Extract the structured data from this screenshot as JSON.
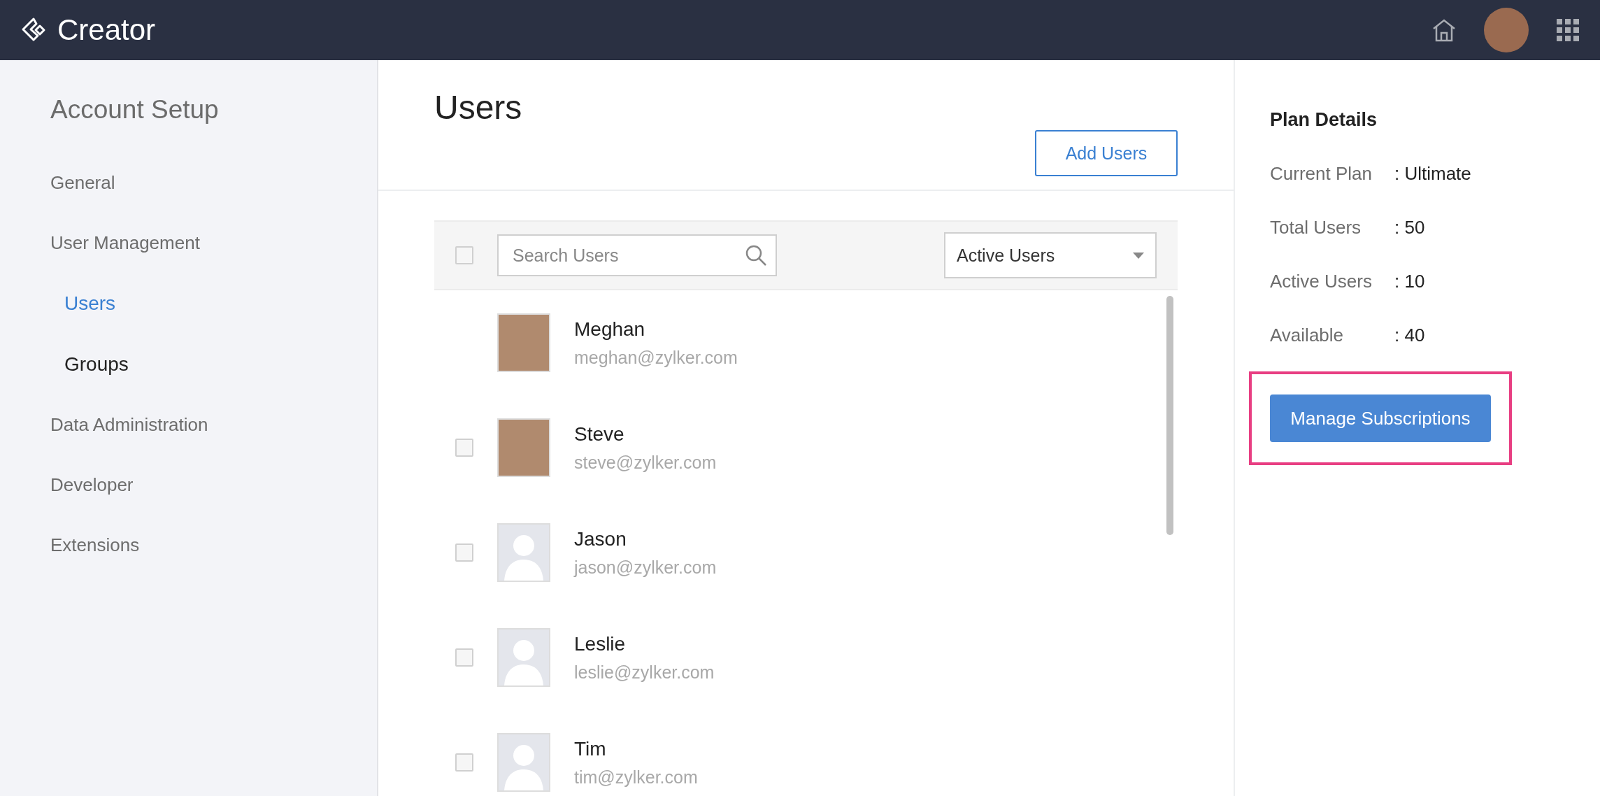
{
  "header": {
    "app_name": "Creator"
  },
  "sidebar": {
    "title": "Account Setup",
    "items": [
      {
        "label": "General",
        "selected": false
      },
      {
        "label": "User Management",
        "selected": false,
        "children": [
          {
            "label": "Users",
            "selected": true
          },
          {
            "label": "Groups",
            "selected": false
          }
        ]
      },
      {
        "label": "Data Administration",
        "selected": false
      },
      {
        "label": "Developer",
        "selected": false
      },
      {
        "label": "Extensions",
        "selected": false
      }
    ]
  },
  "users": {
    "title": "Add Users",
    "heading": "Users",
    "select_all_checked": false,
    "search": {
      "placeholder": "Search Users"
    },
    "filter": "Active Users",
    "rows": [
      {
        "kind": "self",
        "photo": true,
        "name": "Meghan",
        "email": "meghan@zylker.com"
      },
      {
        "kind": "member",
        "photo": true,
        "name": "Steve",
        "email": "steve@zylker.com",
        "checked": false
      },
      {
        "kind": "member",
        "photo": false,
        "name": "Jason",
        "email": "jason@zylker.com",
        "checked": false
      },
      {
        "kind": "member",
        "photo": false,
        "name": "Leslie",
        "email": "leslie@zylker.com",
        "checked": false
      },
      {
        "kind": "member",
        "photo": false,
        "name": "Tim",
        "email": "tim@zylker.com",
        "checked": false
      }
    ]
  },
  "plan": {
    "title": "Plan Details",
    "details": [
      {
        "label": "Current Plan",
        "value": ": Ultimate"
      },
      {
        "label": "Total Users",
        "value": ": 50"
      },
      {
        "label": "Active Users",
        "value": ": 10"
      },
      {
        "label": "Available",
        "value": ": 40"
      }
    ],
    "button": "Manage Subscriptions",
    "button_highlighted": true
  }
}
